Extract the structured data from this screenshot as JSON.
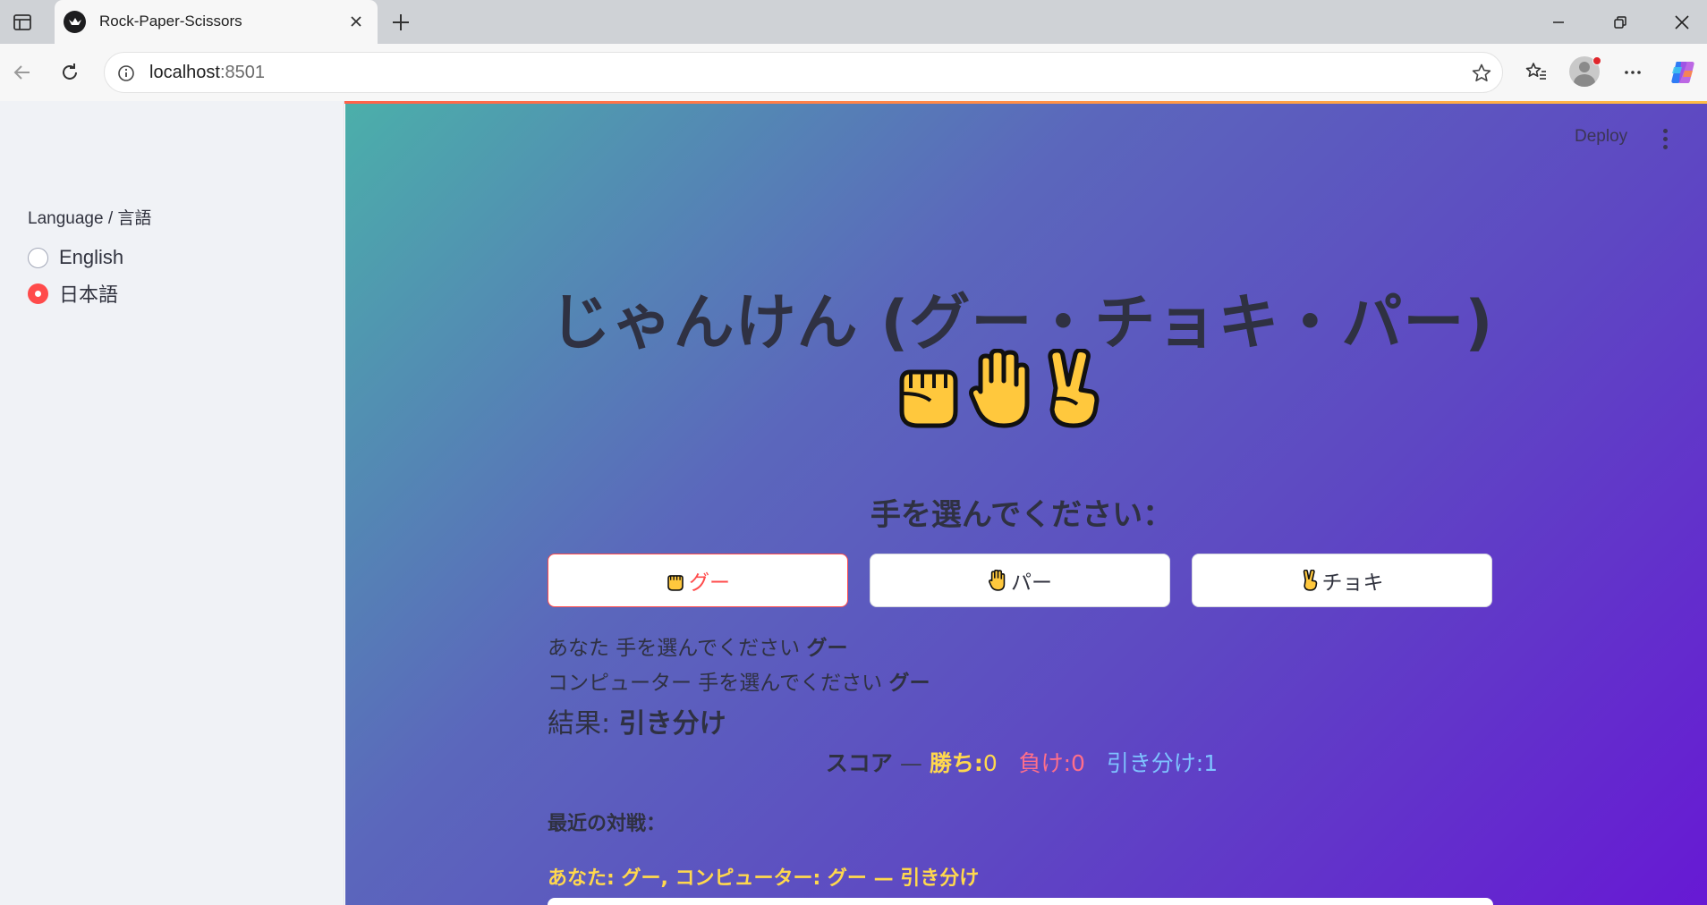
{
  "browser": {
    "tab_title": "Rock-Paper-Scissors",
    "url_host": "localhost",
    "url_port": ":8501"
  },
  "sidebar": {
    "radio_label": "Language / 言語",
    "options": [
      {
        "label": "English",
        "selected": false
      },
      {
        "label": "日本語",
        "selected": true
      }
    ]
  },
  "header": {
    "deploy_label": "Deploy"
  },
  "main": {
    "title": "じゃんけん (グー・チョキ・パー)",
    "title_emojis": [
      "fist-emoji",
      "hand-emoji",
      "victory-emoji"
    ],
    "subtitle": "手を選んでください：",
    "buttons": [
      {
        "label": "グー",
        "icon": "fist-icon",
        "active": true
      },
      {
        "label": "パー",
        "icon": "hand-icon",
        "active": false
      },
      {
        "label": "チョキ",
        "icon": "victory-icon",
        "active": false
      }
    ],
    "you_prefix": "あなた 手を選んでください",
    "you_choice": "グー",
    "cpu_prefix": "コンピューター 手を選んでください",
    "cpu_choice": "グー",
    "result_prefix": "結果:",
    "result_value": "引き分け",
    "score": {
      "label": "スコア",
      "dash": "—",
      "win_label": "勝ち:",
      "win_value": "0",
      "lose_label": "負け:",
      "lose_value": "0",
      "draw_label": "引き分け:",
      "draw_value": "1"
    },
    "recent_heading": "最近の対戦：",
    "history": [
      "あなた: グー, コンピューター: グー — 引き分け"
    ]
  },
  "colors": {
    "accent": "#ff4b4b",
    "win": "#ffd84d",
    "lose": "#ff6f8a",
    "draw": "#7ec3ff"
  }
}
